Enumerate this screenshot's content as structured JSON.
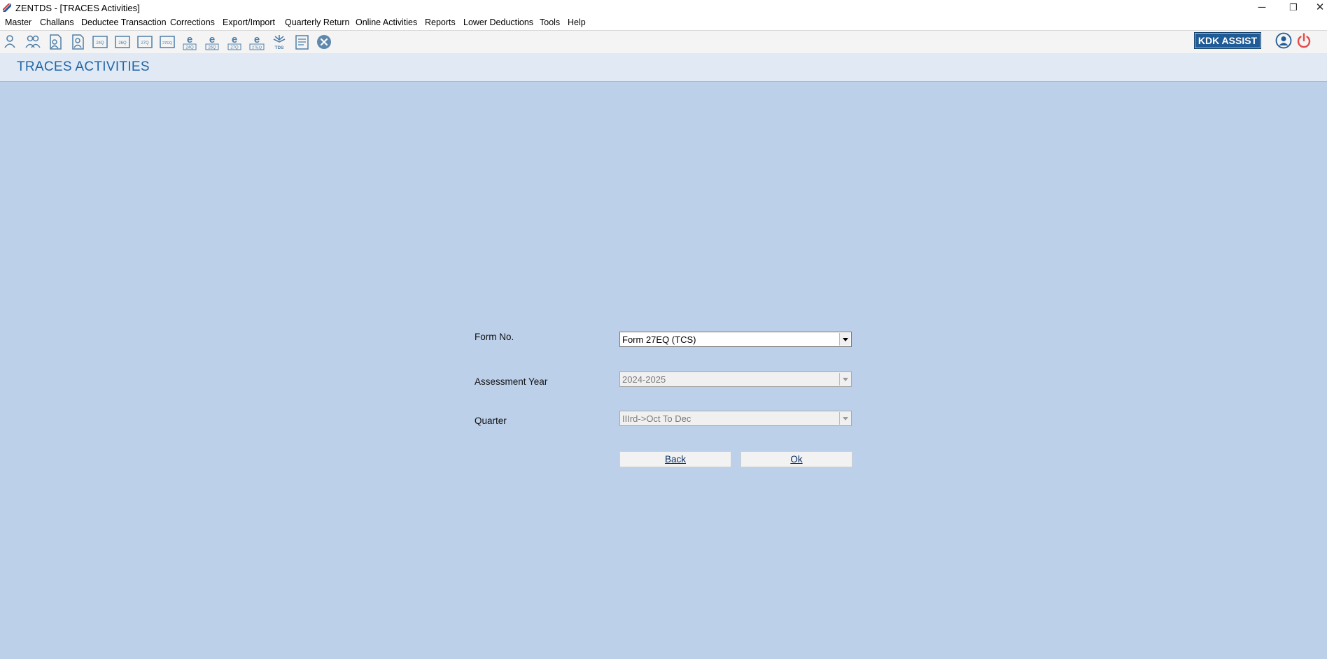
{
  "window": {
    "title": "ZENTDS - [TRACES Activities]",
    "minimize": "─",
    "restore": "❐",
    "close": "✕"
  },
  "menu": [
    "Master",
    "Challans",
    "Deductee Transaction",
    "Corrections",
    "Export/Import",
    "Quarterly Return",
    "Online Activities",
    "Reports",
    "Lower Deductions",
    "Tools",
    "Help"
  ],
  "toolbar": {
    "icons": [
      "user-icon",
      "users-icon",
      "document-user-icon",
      "document-user-edit-icon",
      "form-24q-icon",
      "form-26q-icon",
      "form-27q-icon",
      "form-27eq-icon",
      "e-24q-icon",
      "e-26q-icon",
      "e-27q-icon",
      "e-27eq-icon",
      "tds-icon",
      "report-icon",
      "close-circle-icon"
    ],
    "icon_labels": [
      "",
      "",
      "",
      "",
      "24Q",
      "26Q",
      "27Q",
      "27EQ",
      "24Q",
      "26Q",
      "27Q",
      "27EQ",
      "TDS",
      "",
      ""
    ],
    "kdk_assist": "KDK ASSIST"
  },
  "header": {
    "title": "TRACES ACTIVITIES"
  },
  "form": {
    "form_no_label": "Form No.",
    "form_no_value": "Form 27EQ (TCS)",
    "assessment_year_label": "Assessment Year",
    "assessment_year_value": "2024-2025",
    "quarter_label": "Quarter",
    "quarter_value": "IIIrd->Oct To Dec",
    "back_label": "Back",
    "ok_label": "Ok"
  },
  "colors": {
    "background": "#bcd0ea",
    "header_bg": "#e0e9f4",
    "title": "#1f66a8",
    "kdk": "#1f5b97",
    "power": "#e44a4a"
  }
}
